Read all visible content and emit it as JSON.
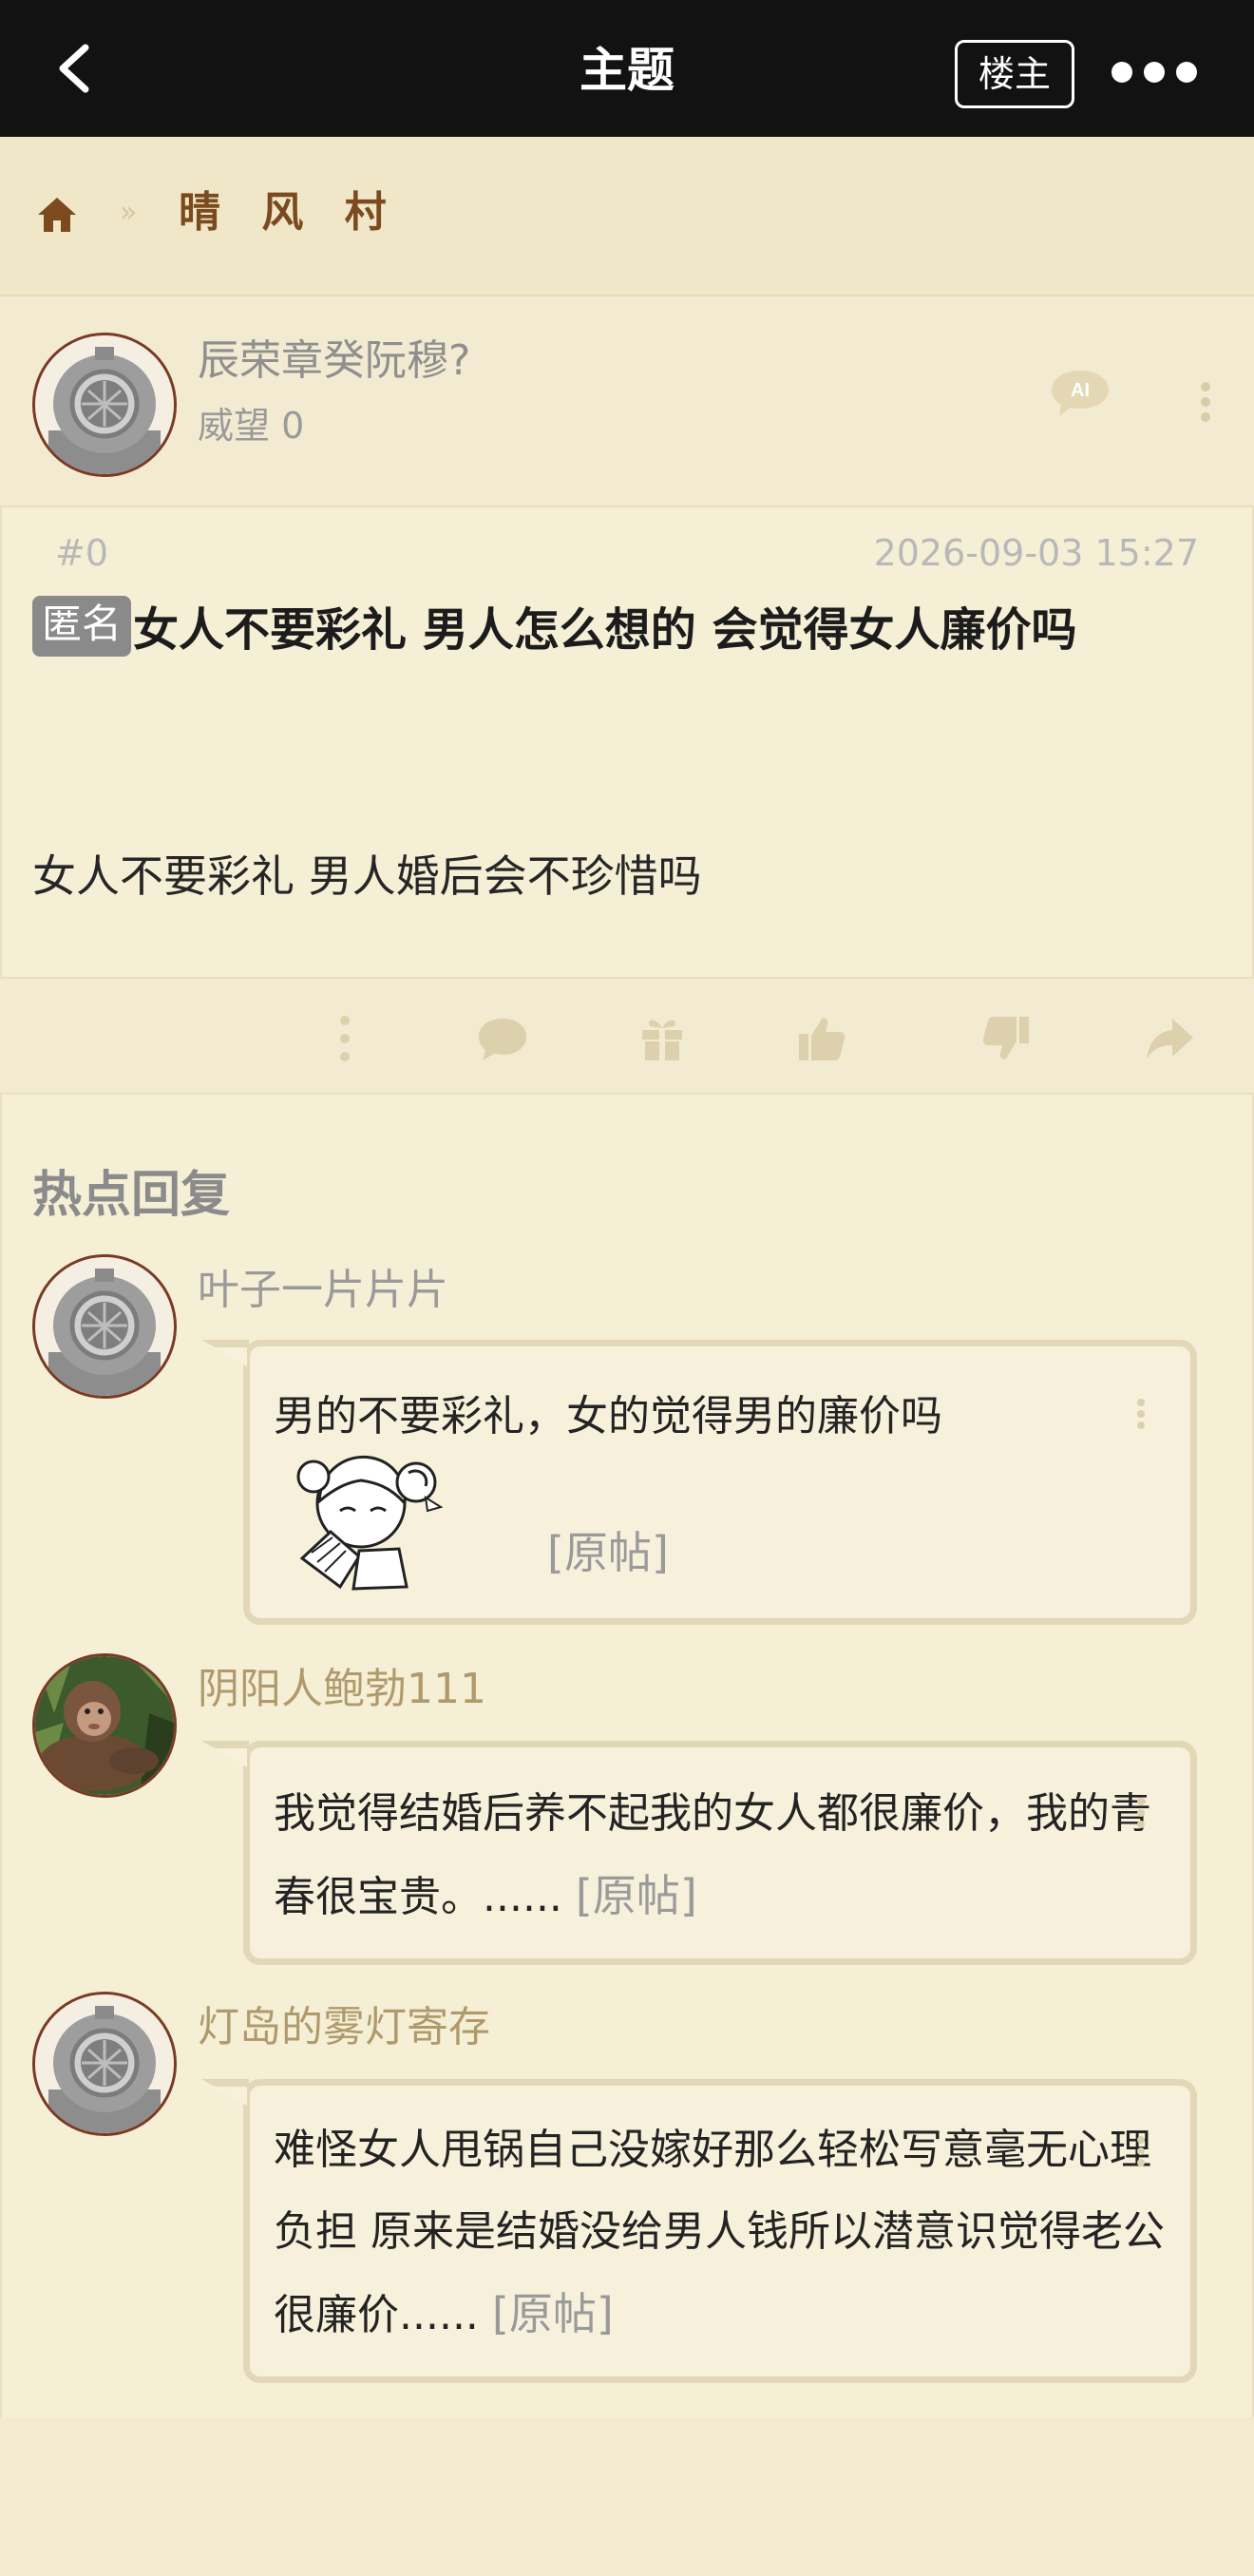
{
  "topbar": {
    "back_icon": "chevron-left-icon",
    "title": "主题",
    "op_label": "楼主",
    "more_icon": "more-dots-icon"
  },
  "breadcrumb": {
    "home_icon": "home-icon",
    "separator": "»",
    "forum": "晴 风 村"
  },
  "post": {
    "author": "辰荣章癸阮穆?",
    "reputation": "威望 0",
    "floor": "#0",
    "time": "2026-09-03 15:27",
    "badge": "匿名",
    "title": "女人不要彩礼 男人怎么想的 会觉得女人廉价吗",
    "body": "女人不要彩礼 男人婚后会不珍惜吗",
    "ai_icon": "ai-chat-icon"
  },
  "actions": [
    "more-vertical-icon",
    "comment-icon",
    "gift-icon",
    "thumbs-up-icon",
    "thumbs-down-icon",
    "share-icon"
  ],
  "hot": {
    "title": "热点回复",
    "replies": [
      {
        "name": "叶子一片片片",
        "text": "男的不要彩礼，女的觉得男的廉价吗",
        "orig": "[原帖]",
        "name_color": "#9a9a9a"
      },
      {
        "name": "阴阳人鲍勃111",
        "text": "我觉得结婚后养不起我的女人都很廉价，我的青春很宝贵。......",
        "orig": "[原帖]",
        "name_color": "#b09a6c"
      },
      {
        "name": "灯岛的雾灯寄存",
        "text": "难怪女人甩锅自己没嫁好那么轻松写意毫无心理负担 原来是结婚没给男人钱所以潜意识觉得老公很廉价......",
        "orig": "[原帖]",
        "name_color": "#b09a6c"
      }
    ]
  },
  "colors": {
    "topbar": "#121212",
    "background": "#f2ebd1",
    "accent": "#7b4a1f",
    "bubble_border": "#e2d7b6"
  }
}
